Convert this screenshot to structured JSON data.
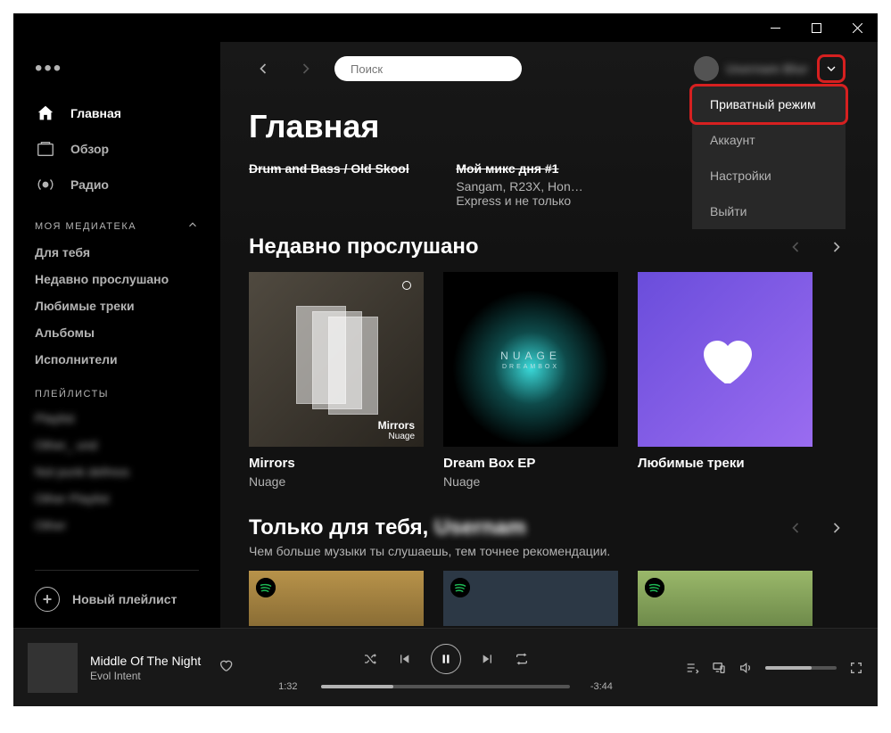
{
  "window": {
    "minimize": "—",
    "maximize": "☐",
    "close": "✕"
  },
  "search": {
    "placeholder": "Поиск"
  },
  "user": {
    "name": "Usernam Blur"
  },
  "dropdown": {
    "private": "Приватный режим",
    "account": "Аккаунт",
    "settings": "Настройки",
    "logout": "Выйти"
  },
  "sidebar": {
    "nav": {
      "home": "Главная",
      "browse": "Обзор",
      "radio": "Радио"
    },
    "library_header": "МОЯ МЕДИАТЕКА",
    "library": {
      "for_you": "Для тебя",
      "recent": "Недавно прослушано",
      "liked": "Любимые треки",
      "albums": "Альбомы",
      "artists": "Исполнители"
    },
    "playlists_header": "ПЛЕЙЛИСТЫ",
    "playlists": [
      "Playlist",
      "Other_ und",
      "Not punk defmos",
      "Other Playlist",
      "Other"
    ],
    "new_playlist": "Новый плейлист"
  },
  "main": {
    "title": "Главная",
    "row_clip": {
      "c1_title": "Drum and Bass / Old Skool",
      "c2_title": "Мой микс дня #1",
      "c2_sub1": "Sangam, R23X, Hon…",
      "c2_sub2": "Express и не только"
    },
    "recent": {
      "header": "Недавно прослушано",
      "cards": [
        {
          "title": "Mirrors",
          "artist": "Nuage",
          "art_line1": "Mirrors",
          "art_line2": "Nuage"
        },
        {
          "title": "Dream Box EP",
          "artist": "Nuage",
          "art_line1": "NUAGE",
          "art_line2": "DREAMBOX"
        },
        {
          "title": "Любимые треки",
          "artist": ""
        }
      ]
    },
    "for_you": {
      "header_prefix": "Только для тебя, ",
      "header_name": "Usernam",
      "sub": "Чем больше музыки ты слушаешь, тем точнее рекомендации."
    }
  },
  "player": {
    "title": "Middle Of The Night",
    "artist": "Evol Intent",
    "elapsed": "1:32",
    "remaining": "-3:44"
  }
}
